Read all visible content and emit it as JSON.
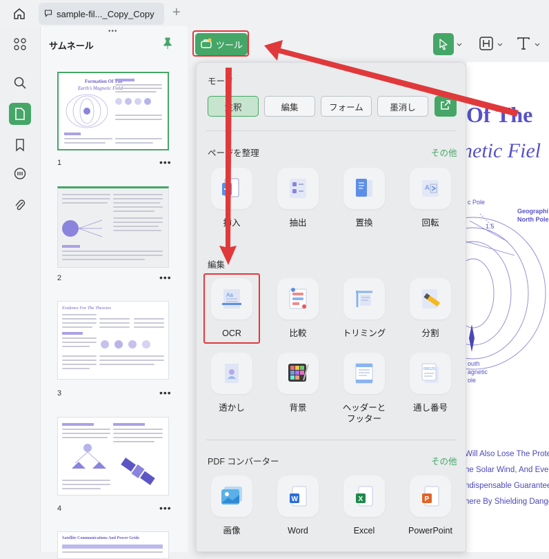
{
  "tab": {
    "title": "sample-fil..._Copy_Copy"
  },
  "thumbnails": {
    "title": "サムネール",
    "pages": [
      {
        "number": "1",
        "heading_line1": "Formation Of The",
        "heading_line2": "Earth's Magnetic Field"
      },
      {
        "number": "2",
        "heading_line1": "",
        "heading_line2": ""
      },
      {
        "number": "3",
        "heading_line1": "Evidence For The Theories",
        "heading_line2": ""
      },
      {
        "number": "4",
        "heading_line1": "",
        "heading_line2": ""
      },
      {
        "number": "",
        "heading_line1": "Satellite Communications And Power Grids",
        "heading_line2": ""
      }
    ],
    "more": "•••"
  },
  "toolbar": {
    "tool_label": "ツール"
  },
  "pdf": {
    "title_line1": "Of The",
    "title_line2": "netic Fiel",
    "label_pole": "c Pole",
    "label_geo1": "Geographi",
    "label_geo2": "North Pole",
    "label_15": "1.5",
    "label_south1": "outh",
    "label_south2": "agnetic",
    "label_south3": "ole",
    "body": [
      "Will Also Lose The Prote",
      "he Solar Wind, And Even",
      "ndispensable Guarantee",
      "here By Shielding Dange"
    ]
  },
  "popup": {
    "mode": {
      "label": "モード",
      "buttons": [
        "注釈",
        "編集",
        "フォーム",
        "墨消し"
      ],
      "active_index": 0
    },
    "organize": {
      "label": "ページを整理",
      "more": "その他",
      "items": [
        {
          "label": "挿入",
          "icon": "insert-page-icon"
        },
        {
          "label": "抽出",
          "icon": "extract-page-icon"
        },
        {
          "label": "置換",
          "icon": "replace-page-icon"
        },
        {
          "label": "回転",
          "icon": "rotate-page-icon"
        }
      ]
    },
    "edit": {
      "label": "編集",
      "items": [
        {
          "label": "OCR",
          "icon": "ocr-icon"
        },
        {
          "label": "比較",
          "icon": "compare-icon"
        },
        {
          "label": "トリミング",
          "icon": "crop-icon"
        },
        {
          "label": "分割",
          "icon": "split-icon"
        },
        {
          "label": "透かし",
          "icon": "watermark-icon"
        },
        {
          "label": "背景",
          "icon": "background-icon"
        },
        {
          "label": "ヘッダーと\nフッター",
          "icon": "header-footer-icon"
        },
        {
          "label": "通し番号",
          "icon": "bates-number-icon"
        }
      ]
    },
    "converter": {
      "label": "PDF コンバーター",
      "more": "その他",
      "items": [
        {
          "label": "画像",
          "icon": "image-convert-icon"
        },
        {
          "label": "Word",
          "icon": "word-icon"
        },
        {
          "label": "Excel",
          "icon": "excel-icon"
        },
        {
          "label": "PowerPoint",
          "icon": "powerpoint-icon"
        }
      ]
    }
  },
  "colors": {
    "accent": "#45a667",
    "highlight": "#e0393b",
    "pdf_text": "#5752c9"
  }
}
